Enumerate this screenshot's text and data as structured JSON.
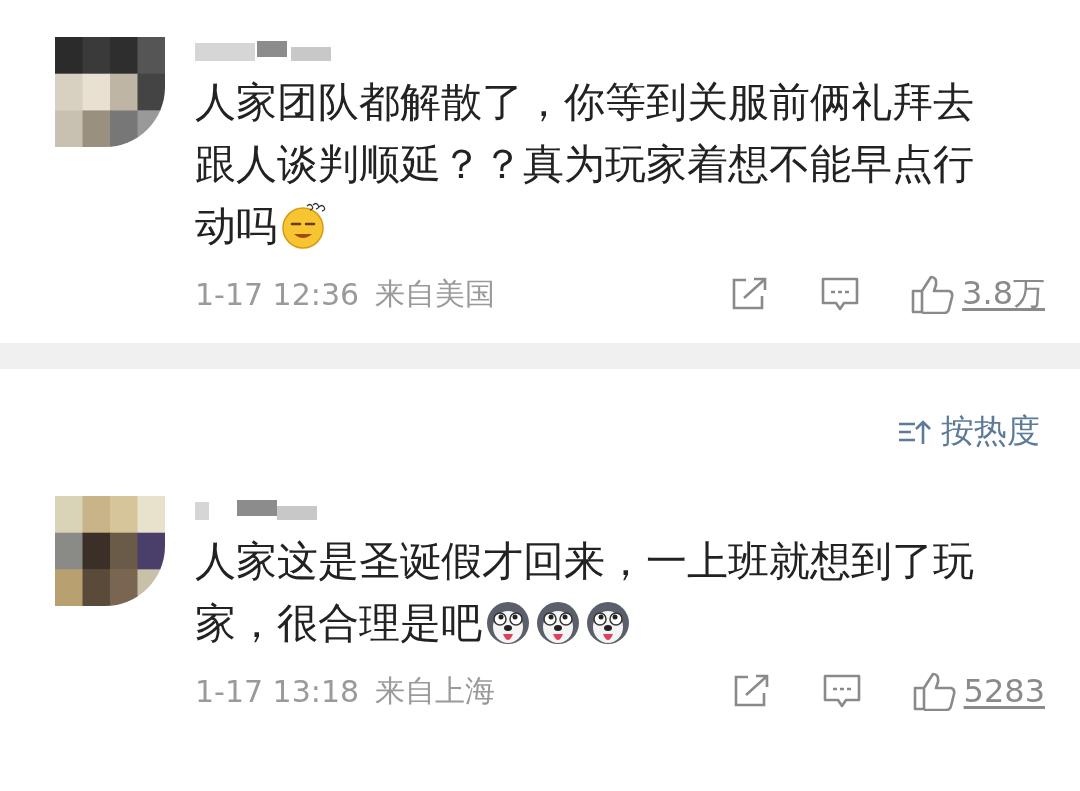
{
  "comments": [
    {
      "lines": [
        "人家团队都解散了，你等到关服前俩礼拜去",
        "跟人谈判顺延？？真为玩家着想不能早点行",
        "动吗"
      ],
      "emojis": [
        {
          "kind": "smirk"
        }
      ],
      "time": "1-17 12:36",
      "location": "来自美国",
      "likes": "3.8万"
    },
    {
      "lines": [
        "人家这是圣诞假才回来，一上班就想到了玩",
        "家，很合理是吧"
      ],
      "emojis": [
        {
          "kind": "husky"
        },
        {
          "kind": "husky"
        },
        {
          "kind": "husky"
        }
      ],
      "time": "1-17 13:18",
      "location": "来自上海",
      "likes": "5283"
    }
  ],
  "sort": {
    "label": "按热度"
  }
}
